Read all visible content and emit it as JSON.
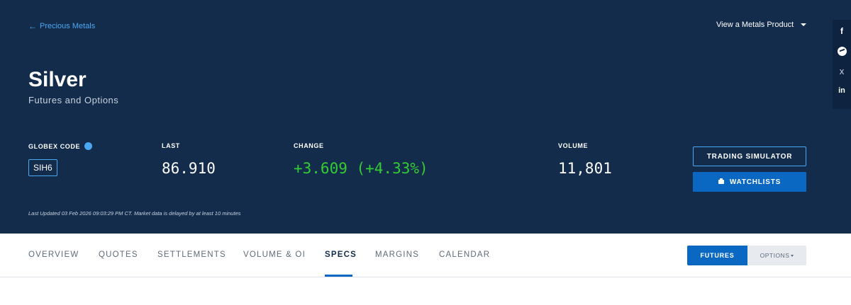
{
  "header": {
    "back_link": "Precious Metals",
    "product_menu": "View a Metals Product",
    "title": "Silver",
    "subtitle": "Futures and Options"
  },
  "social": [
    "f",
    "x",
    "in"
  ],
  "quote": {
    "globex_label": "GLOBEX CODE",
    "globex_code": "SIH6",
    "last_label": "LAST",
    "last_value": "86.910",
    "change_label": "CHANGE",
    "change_value": "+3.609 (+4.33%)",
    "volume_label": "VOLUME",
    "volume_value": "11,801",
    "last_updated": "Last Updated 03 Feb 2026 09:03:29 PM CT.  Market data is delayed by at least 10 minutes"
  },
  "actions": {
    "simulator": "TRADING SIMULATOR",
    "watchlists": "WATCHLISTS"
  },
  "tabs": [
    {
      "label": "OVERVIEW"
    },
    {
      "label": "QUOTES"
    },
    {
      "label": "SETTLEMENTS"
    },
    {
      "label": "VOLUME & OI"
    },
    {
      "label": "SPECS"
    },
    {
      "label": "MARGINS"
    },
    {
      "label": "CALENDAR"
    }
  ],
  "active_tab": "SPECS",
  "segment": {
    "futures": "FUTURES",
    "options": "OPTIONS"
  },
  "colors": {
    "navy": "#132c4c",
    "accent_blue": "#0a67c2",
    "link_blue": "#4ba8f2",
    "up_green": "#33cc33"
  },
  "icons": {
    "back": "arrow-left-icon",
    "menu": "chevron-down-icon",
    "globex_info": "info-icon",
    "watchlists": "briefcase-icon",
    "facebook": "facebook-icon",
    "messenger": "messenger-icon",
    "x": "x-icon",
    "linkedin": "linkedin-icon"
  }
}
